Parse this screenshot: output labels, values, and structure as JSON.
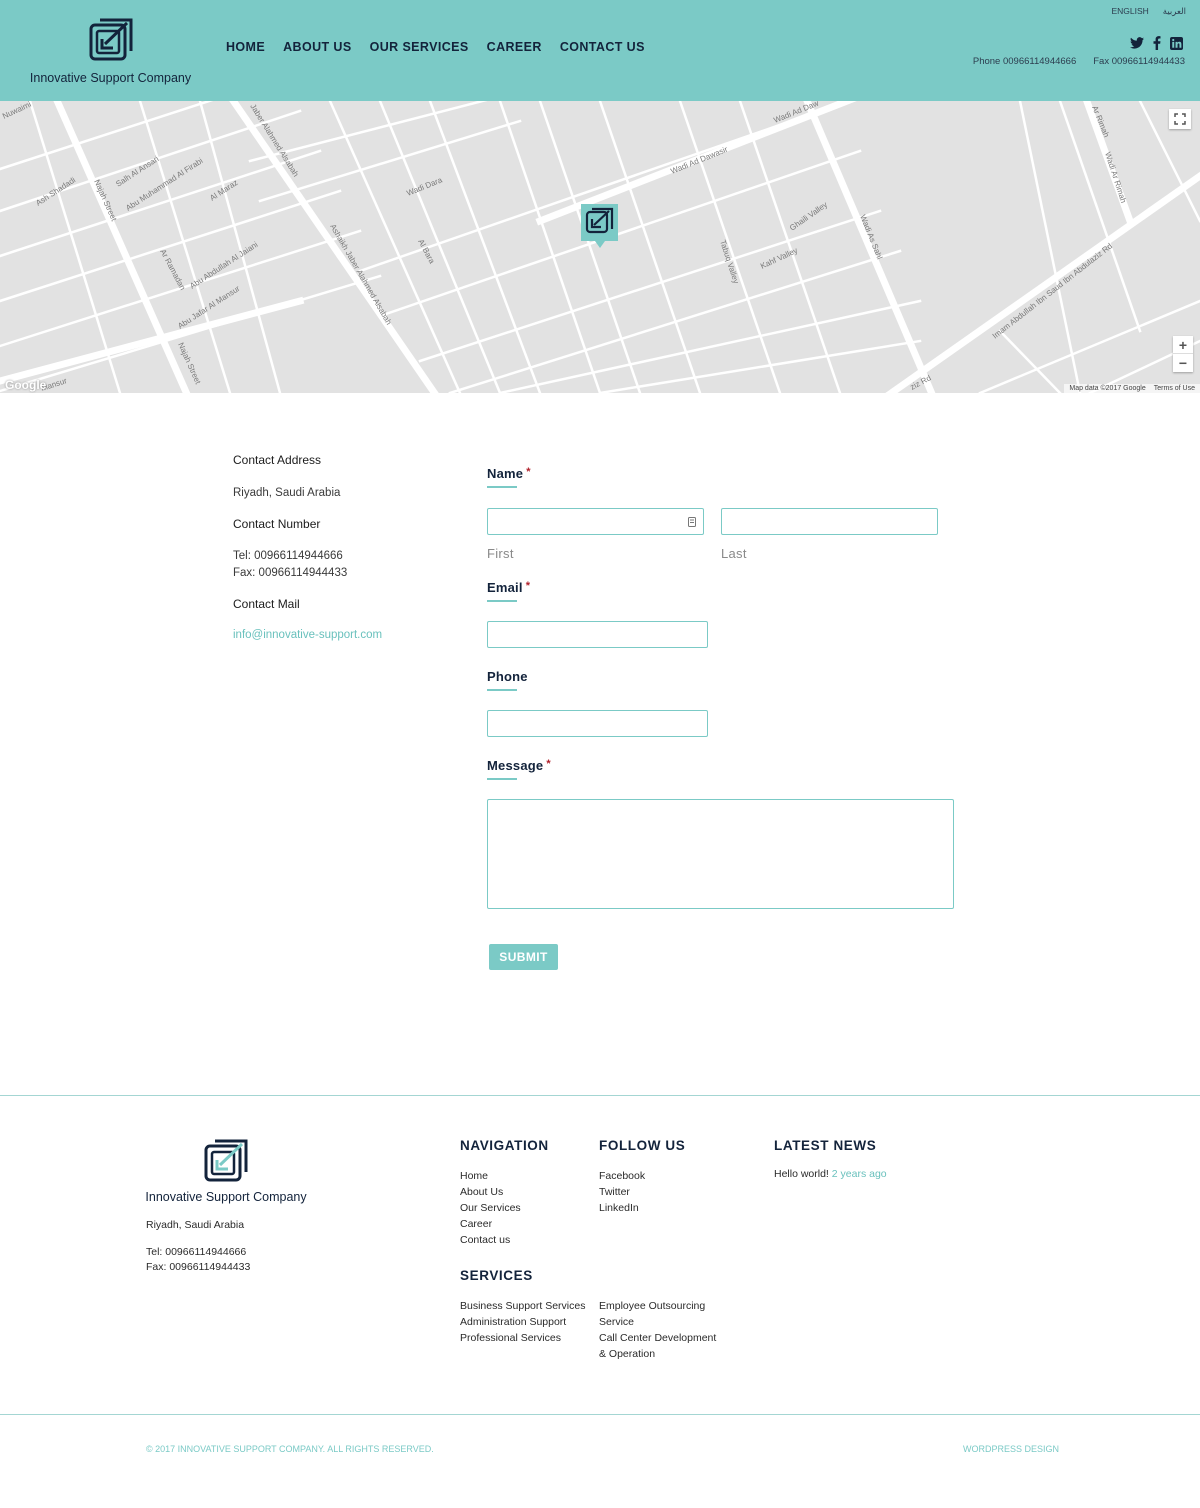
{
  "brand": {
    "name": "Innovative Support Company",
    "accent_color": "#7bcac6",
    "dark_color": "#13233b"
  },
  "header": {
    "nav": [
      "HOME",
      "ABOUT US",
      "OUR SERVICES",
      "CAREER",
      "CONTACT US"
    ],
    "languages": [
      "ENGLISH",
      "العربية"
    ],
    "social_icons": [
      "twitter-icon",
      "facebook-icon",
      "linkedin-icon"
    ],
    "phone": "Phone 00966114944666",
    "fax": "Fax 00966114944433"
  },
  "map": {
    "google_logo": "Google",
    "attribution": "Map data ©2017 Google",
    "terms": "Terms of Use",
    "zoom_in": "+",
    "zoom_out": "−",
    "street_labels": [
      "Wadi Ad Dawasir",
      "Wadi Ad Daw",
      "Wadi As Sahl",
      "Ar Rimah",
      "Wadi Ar Rimah",
      "Imam Abdullah Ibn Saud Ibn Abdulaziz Rd",
      "Najah Street",
      "Najah Street",
      "Jaber Alahmed Alsabah",
      "Ashaikh Jaber Alahmed Alsabah",
      "Salh Al Ansari",
      "Abu Jafar Al Mansur",
      "Abu Abdullah Al Jaiani",
      "Abu Muhammad Al Firabi",
      "Ar Ramadan",
      "Al Maraz",
      "Ash Shadadi",
      "Wadi Dara",
      "Al Bara",
      "Ghaili Valley",
      "Tabuq Valley",
      "Kahf Valley",
      "ziz Rd",
      "Mansur",
      "Nuwaimi"
    ]
  },
  "contact_info": {
    "address_heading": "Contact Address",
    "address": "Riyadh, Saudi Arabia",
    "number_heading": "Contact Number",
    "tel": "Tel: 00966114944666",
    "fax": "Fax: 00966114944433",
    "mail_heading": "Contact Mail",
    "email": "info@innovative-support.com"
  },
  "form": {
    "name_label": "Name",
    "required_mark": "*",
    "first_sublabel": "First",
    "last_sublabel": "Last",
    "email_label": "Email",
    "phone_label": "Phone",
    "message_label": "Message",
    "submit_label": "SUBMIT",
    "first_value": "",
    "last_value": "",
    "email_value": "",
    "phone_value": "",
    "message_value": ""
  },
  "footer": {
    "logo_text": "Innovative Support Company",
    "address": "Riyadh, Saudi Arabia",
    "tel": "Tel: 00966114944666",
    "fax": "Fax: 00966114944433",
    "navigation_heading": "NAVIGATION",
    "navigation_links": [
      "Home",
      "About Us",
      "Our Services",
      "Career",
      "Contact us"
    ],
    "follow_heading": "FOLLOW US",
    "follow_links": [
      "Facebook",
      "Twitter",
      "LinkedIn"
    ],
    "news_heading": "LATEST NEWS",
    "news_title": "Hello world!",
    "news_time": "2 years ago",
    "services_heading": "SERVICES",
    "services_col1": [
      "Business Support Services",
      "Administration Support",
      "Professional Services"
    ],
    "services_col2": [
      "Employee Outsourcing",
      "Service",
      "Call Center Development",
      "& Operation"
    ],
    "copyright": "© 2017 INNOVATIVE SUPPORT COMPANY. ALL RIGHTS RESERVED.",
    "credit": "WORDPRESS DESIGN"
  }
}
